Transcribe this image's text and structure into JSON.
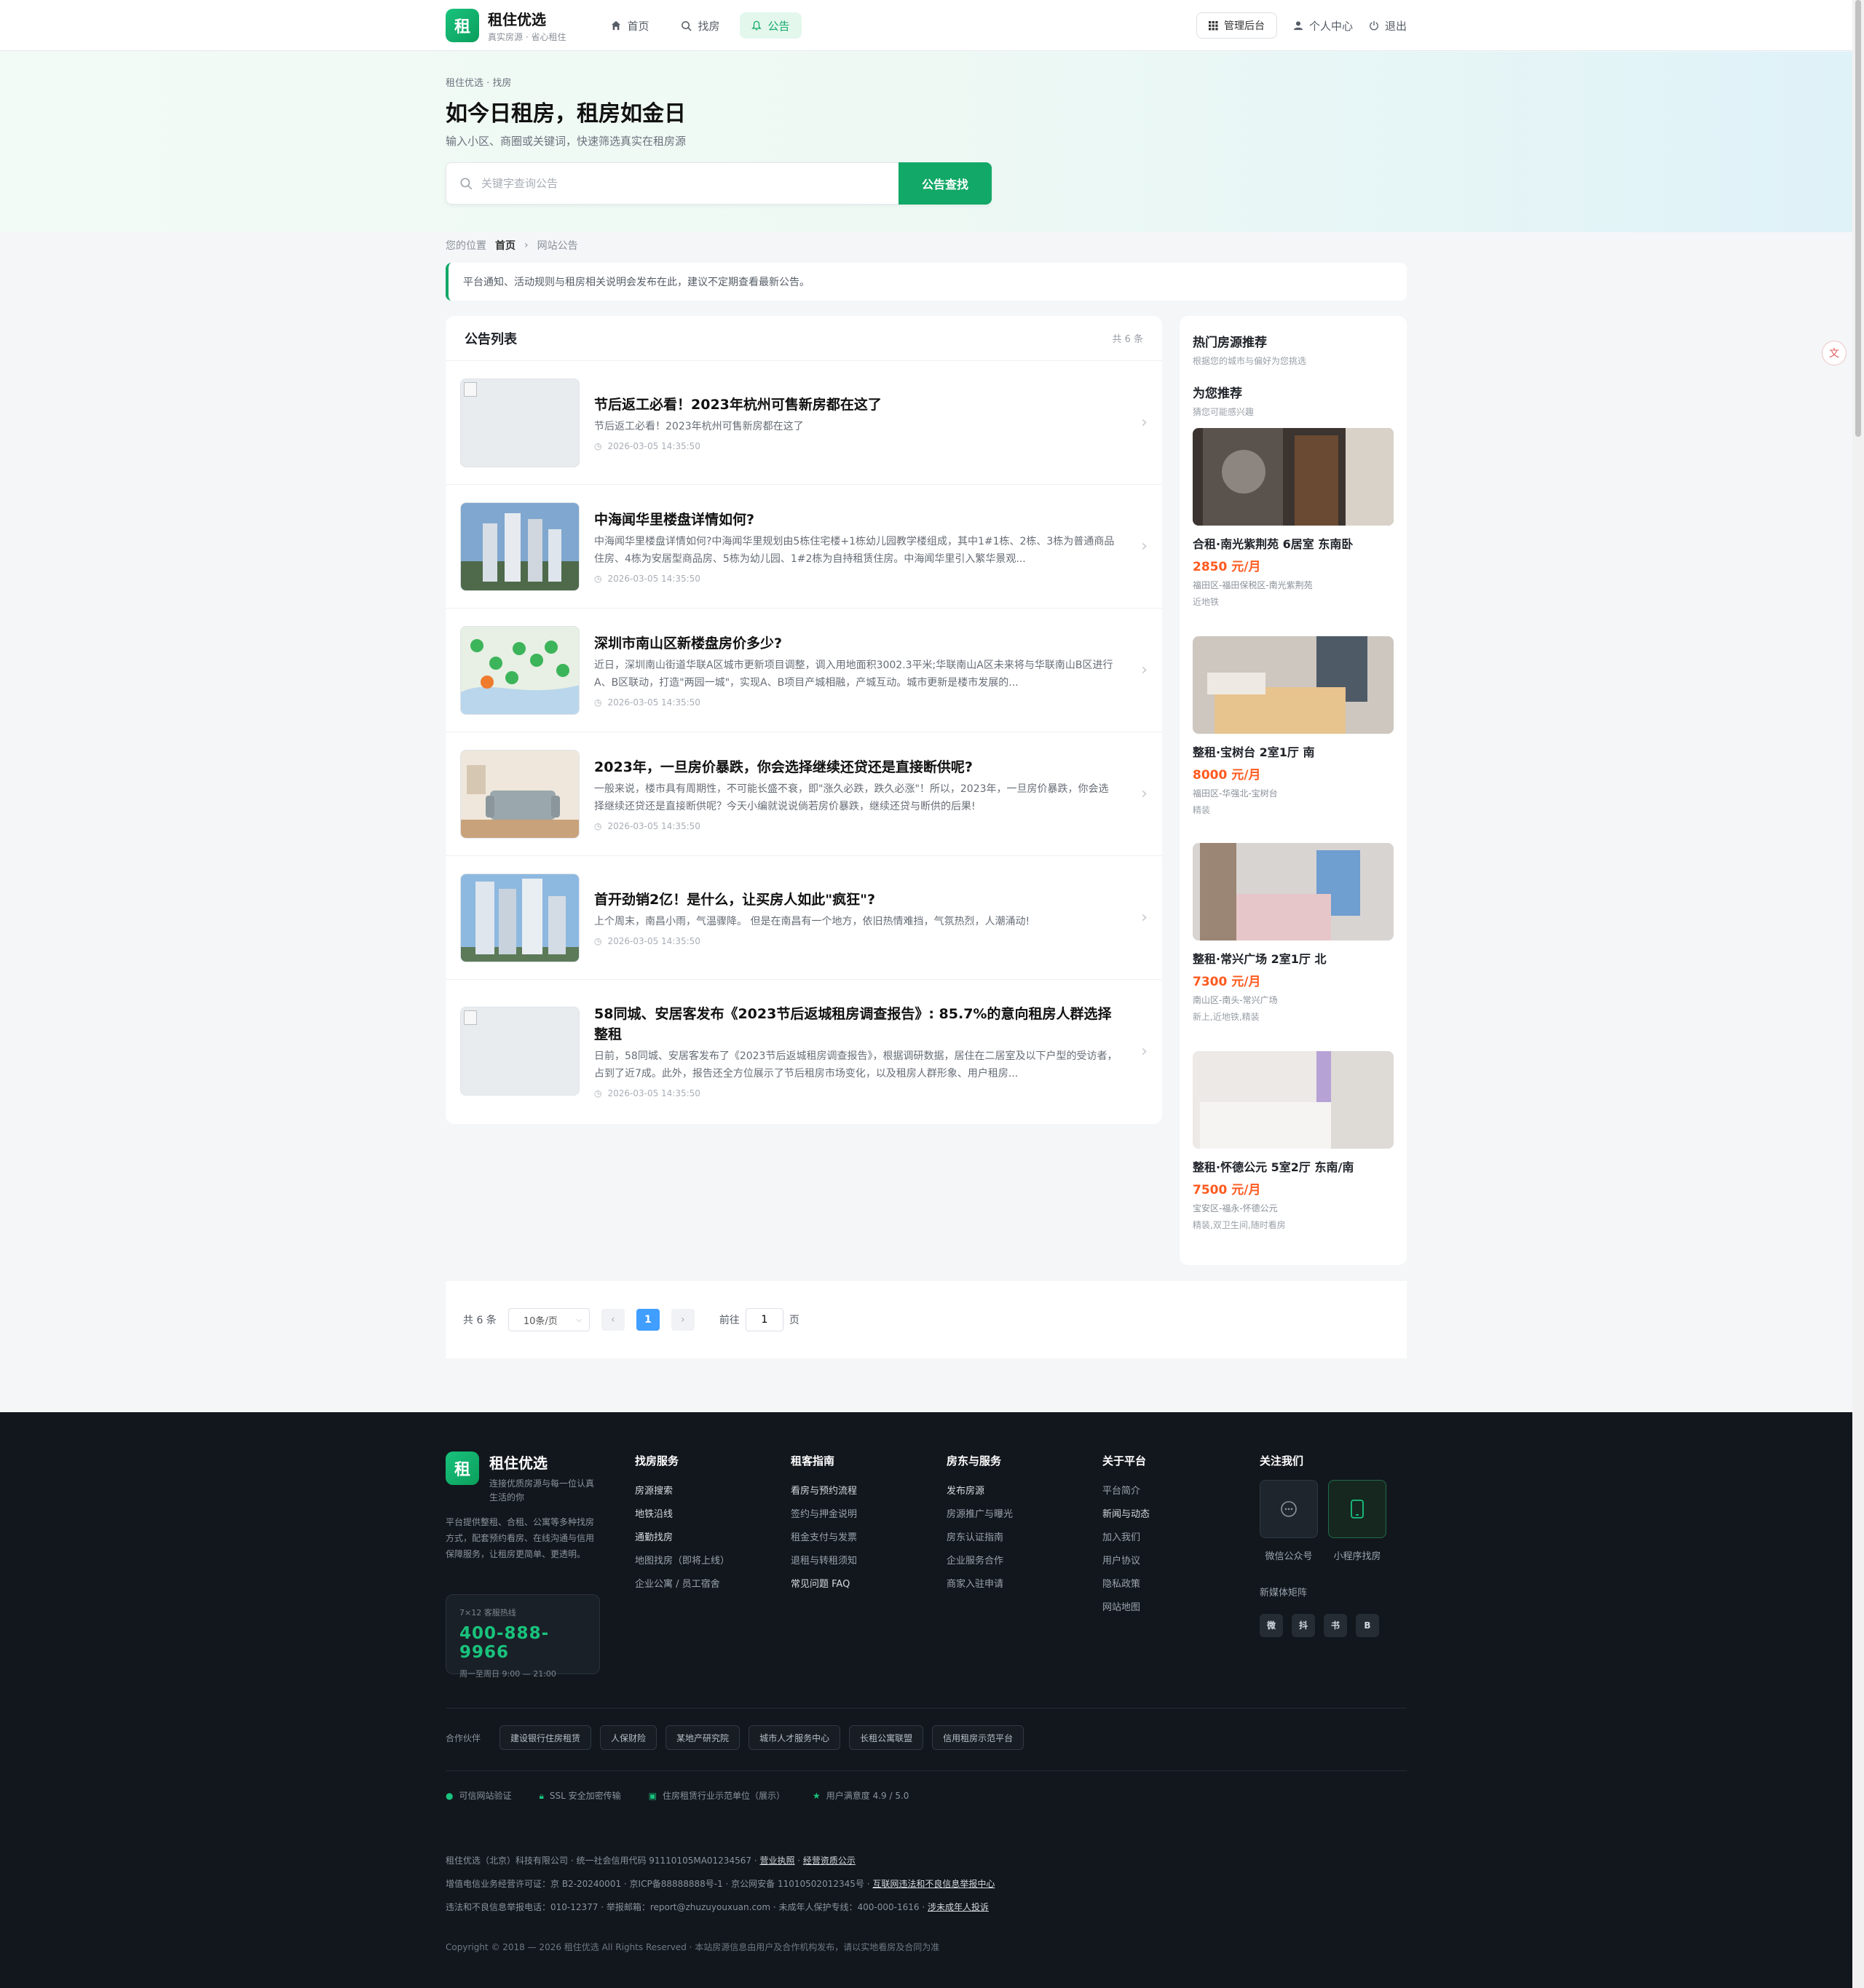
{
  "header": {
    "logo_char": "租",
    "brand_name": "租住优选",
    "brand_sub": "真实房源 · 省心租住",
    "nav": [
      {
        "label": "首页",
        "icon": "home-icon"
      },
      {
        "label": "找房",
        "icon": "search-icon"
      },
      {
        "label": "公告",
        "icon": "bell-icon",
        "active": true
      }
    ],
    "admin": "管理后台",
    "profile": "个人中心",
    "logout": "退出"
  },
  "hero": {
    "breadcrumb": "租住优选 · 找房",
    "title": "如今日租房，租房如金日",
    "subtitle": "输入小区、商圈或关键词，快速筛选真实在租房源",
    "search_placeholder": "关键字查询公告",
    "search_button": "公告查找"
  },
  "location": {
    "label": "您的位置",
    "home": "首页",
    "sep": "›",
    "current": "网站公告"
  },
  "notice": "平台通知、活动规则与租房相关说明会发布在此，建议不定期查看最新公告。",
  "list": {
    "title": "公告列表",
    "count": "共 6 条",
    "items": [
      {
        "title": "节后返工必看！2023年杭州可售新房都在这了",
        "desc": "节后返工必看！2023年杭州可售新房都在这了",
        "time": "2026-03-05 14:35:50"
      },
      {
        "title": "中海闻华里楼盘详情如何?",
        "desc": "中海闻华里楼盘详情如何?中海闻华里规划由5栋住宅楼+1栋幼儿园教学楼组成，其中1#1栋、2栋、3栋为普通商品住房、4栋为安居型商品房、5栋为幼儿园、1#2栋为自持租赁住房。中海闻华里引入繁华景观...",
        "time": "2026-03-05 14:35:50"
      },
      {
        "title": "深圳市南山区新楼盘房价多少?",
        "desc": "近日，深圳南山街道华联A区城市更新项目调整，调入用地面积3002.3平米;华联南山A区未来将与华联南山B区进行A、B区联动，打造\"两园一城\"，实现A、B项目产城相融，产城互动。城市更新是楼市发展的...",
        "time": "2026-03-05 14:35:50"
      },
      {
        "title": "2023年，一旦房价暴跌，你会选择继续还贷还是直接断供呢?",
        "desc": "一般来说，楼市具有周期性，不可能长盛不衰，即\"涨久必跌，跌久必涨\"！所以，2023年，一旦房价暴跌，你会选择继续还贷还是直接断供呢？今天小编就说说倘若房价暴跌，继续还贷与断供的后果!",
        "time": "2026-03-05 14:35:50"
      },
      {
        "title": "首开劲销2亿！是什么，让买房人如此\"疯狂\"?",
        "desc": "上个周末，南昌小雨，气温骤降。 但是在南昌有一个地方，依旧热情难挡，气氛热烈，人潮涌动!",
        "time": "2026-03-05 14:35:50"
      },
      {
        "title": "58同城、安居客发布《2023节后返城租房调查报告》: 85.7%的意向租房人群选择整租",
        "desc": "日前，58同城、安居客发布了《2023节后返城租房调查报告》，根据调研数据，居住在二居室及以下户型的受访者，占到了近7成。此外，报告还全方位展示了节后租房市场变化，以及租房人群形象、用户租房...",
        "time": "2026-03-05 14:35:50"
      }
    ]
  },
  "sidebar": {
    "title": "热门房源推荐",
    "subtitle": "根据您的城市与偏好为您挑选",
    "rec_title": "为您推荐",
    "rec_sub": "猜您可能感兴趣",
    "houses": [
      {
        "title": "合租·南光紫荆苑 6居室 东南卧",
        "price": "2850 元/月",
        "location": "福田区-福田保税区-南光紫荆苑",
        "tags": "近地铁"
      },
      {
        "title": "整租·宝树台 2室1厅 南",
        "price": "8000 元/月",
        "location": "福田区-华强北-宝树台",
        "tags": "精装"
      },
      {
        "title": "整租·常兴广场 2室1厅 北",
        "price": "7300 元/月",
        "location": "南山区-南头-常兴广场",
        "tags": "新上,近地铁,精装"
      },
      {
        "title": "整租·怀德公元 5室2厅 东南/南",
        "price": "7500 元/月",
        "location": "宝安区-福永-怀德公元",
        "tags": "精装,双卫生间,随时看房"
      }
    ]
  },
  "pager": {
    "total": "共 6 条",
    "size": "10条/页",
    "page": "1",
    "goto_label": "前往",
    "goto_value": "1",
    "page_unit": "页"
  },
  "footer": {
    "brand": "租住优选",
    "slogan": "连接优质房源与每一位认真生活的你",
    "intro": "平台提供整租、合租、公寓等多种找房方式，配套预约看房、在线沟通与信用保障服务，让租房更简单、更透明。",
    "hotline_label": "7×12 客服热线",
    "hotline": "400-888-9966",
    "hotline_time": "周一至周日 9:00 — 21:00",
    "cols": [
      {
        "title": "找房服务",
        "items": [
          "房源搜索",
          "地铁沿线",
          "通勤找房",
          "地图找房（即将上线）",
          "企业公寓 / 员工宿舍"
        ]
      },
      {
        "title": "租客指南",
        "items": [
          "看房与预约流程",
          "签约与押金说明",
          "租金支付与发票",
          "退租与转租须知",
          "常见问题 FAQ"
        ]
      },
      {
        "title": "房东与服务",
        "items": [
          "发布房源",
          "房源推广与曝光",
          "房东认证指南",
          "企业服务合作",
          "商家入驻申请"
        ]
      },
      {
        "title": "关于平台",
        "items": [
          "平台简介",
          "新闻与动态",
          "加入我们",
          "用户协议",
          "隐私政策",
          "网站地图"
        ]
      }
    ],
    "follow_title": "关注我们",
    "qr": [
      {
        "label": "微信公众号"
      },
      {
        "label": "小程序找房"
      }
    ],
    "media_title": "新媒体矩阵",
    "media": [
      "微",
      "抖",
      "书",
      "B"
    ],
    "partners_label": "合作伙伴",
    "partners": [
      "建设银行住房租赁",
      "人保财险",
      "某地产研究院",
      "城市人才服务中心",
      "长租公寓联盟",
      "信用租房示范平台"
    ],
    "badges": [
      "可信网站验证",
      "SSL 安全加密传输",
      "住房租赁行业示范单位（展示）",
      "用户满意度 4.9 / 5.0"
    ],
    "legal1": "租住优选（北京）科技有限公司 · 统一社会信用代码 91110105MA01234567 ·",
    "legal1_links": [
      "营业执照",
      "经营资质公示"
    ],
    "legal2": "增值电信业务经营许可证：京 B2-20240001 · 京ICP备88888888号-1 · 京公网安备 11010502012345号 ·",
    "legal2_link": "互联网违法和不良信息举报中心",
    "legal3": "违法和不良信息举报电话：010-12377 · 举报邮箱：report@zhuzuyouxuan.com · 未成年人保护专线：400-000-1616 ·",
    "legal3_link": "涉未成年人投诉",
    "copyright": "Copyright © 2018 — 2026 租住优选 All Rights Reserved · 本站房源信息由用户及合作机构发布，请以实地看房及合同为准"
  }
}
